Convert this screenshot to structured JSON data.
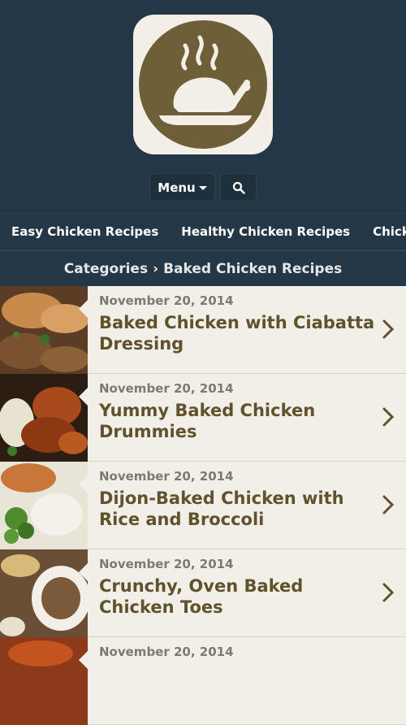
{
  "header": {
    "menu_label": "Menu"
  },
  "nav": {
    "items": [
      {
        "label": "Easy Chicken Recipes"
      },
      {
        "label": "Healthy Chicken Recipes"
      },
      {
        "label": "Chicken Parmesan"
      }
    ]
  },
  "breadcrumb": {
    "root": "Categories",
    "separator": "›",
    "current": "Baked Chicken Recipes"
  },
  "recipes": [
    {
      "date": "November 20, 2014",
      "title": "Baked Chicken with Ciabatta Dressing"
    },
    {
      "date": "November 20, 2014",
      "title": "Yummy Baked Chicken Drummies"
    },
    {
      "date": "November 20, 2014",
      "title": "Dijon-Baked Chicken with Rice and Broccoli"
    },
    {
      "date": "November 20, 2014",
      "title": "Crunchy, Oven Baked Chicken Toes"
    },
    {
      "date": "November 20, 2014",
      "title": ""
    }
  ],
  "colors": {
    "header_bg": "#243746",
    "title_text": "#5f522c",
    "logo_brown": "#6e5f39",
    "list_bg": "#f2efe9"
  }
}
